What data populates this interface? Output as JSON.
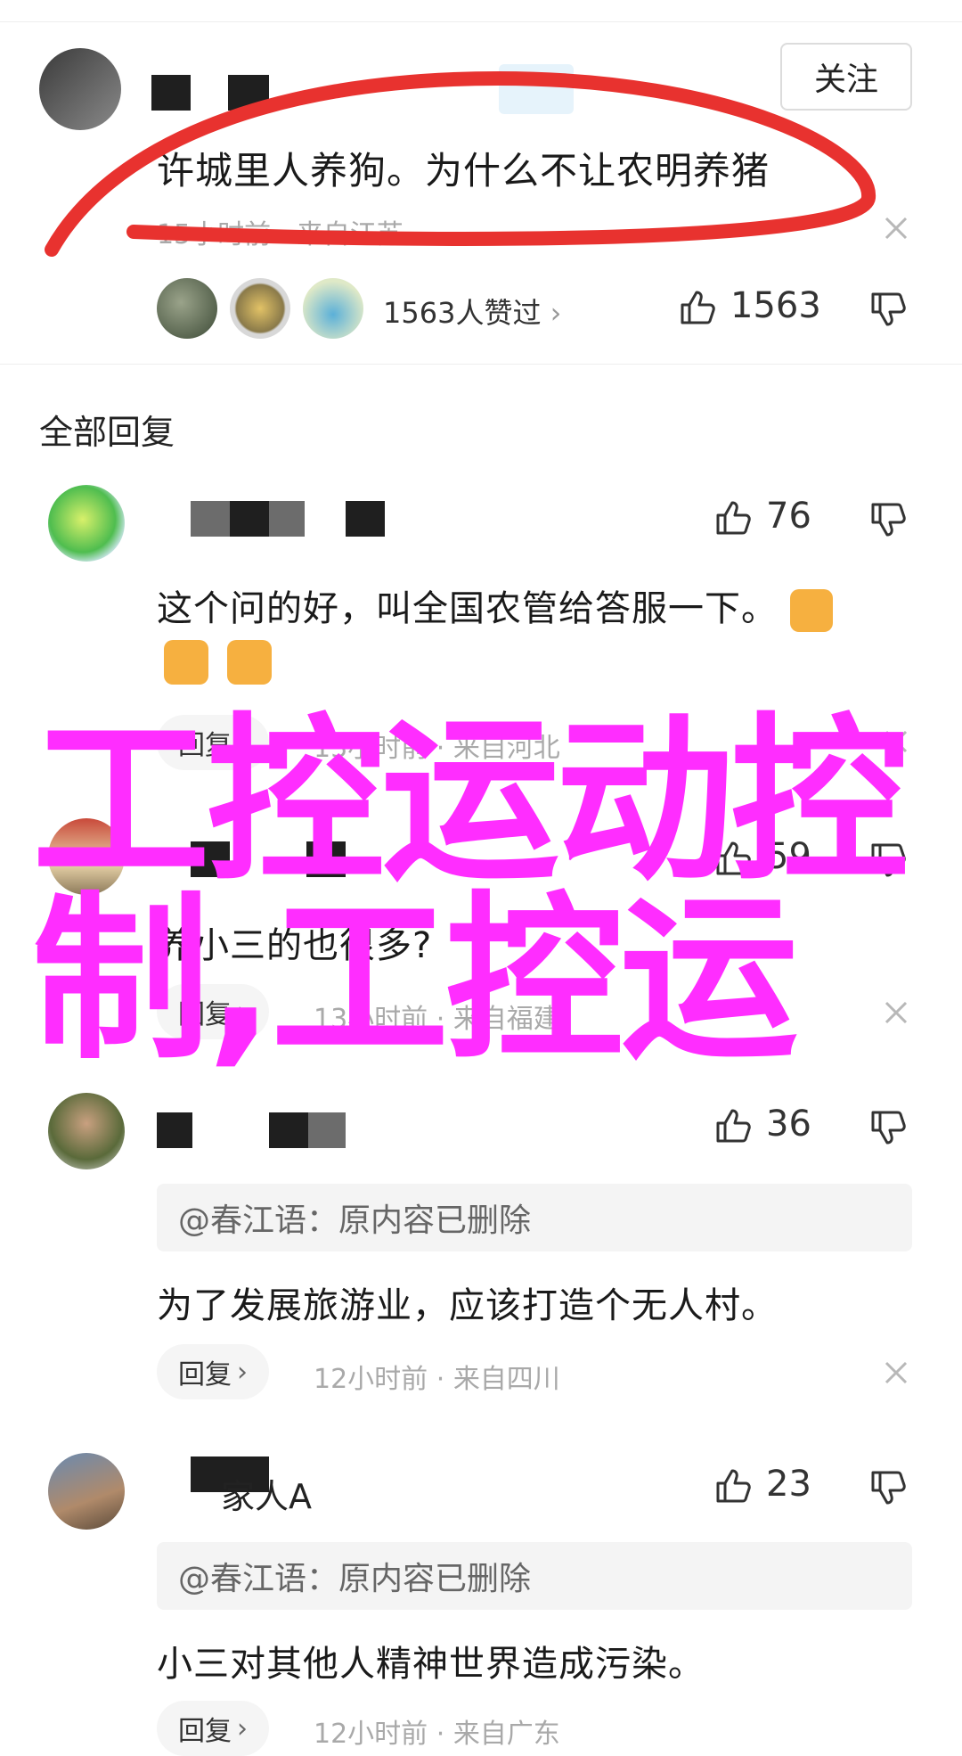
{
  "post": {
    "follow_label": "关注",
    "content": "许城里人养狗。为什么不让农明养猪",
    "time": "15小时前",
    "location": "来自江苏",
    "likes_summary": "1563人赞过",
    "like_count": "1563"
  },
  "replies_header": "全部回复",
  "comments": [
    {
      "like_count": "76",
      "text_line1": "这个问的好，叫全国农管给答服一下。",
      "reply_label": "回复",
      "time": "13小时前",
      "location": "来自河北"
    },
    {
      "like_count": "59",
      "text": "养小三的也很多?",
      "reply_label": "回复",
      "time": "13小时前",
      "location": "来自福建"
    },
    {
      "like_count": "36",
      "quote": "@春江语：原内容已删除",
      "text": "为了发展旅游业，应该打造个无人村。",
      "reply_label": "回复",
      "time": "12小时前",
      "location": "来自四川"
    },
    {
      "like_count": "23",
      "name_tail": "家人A",
      "quote": "@春江语：原内容已删除",
      "text": "小三对其他人精神世界造成污染。",
      "reply_label": "回复",
      "time": "12小时前",
      "location": "来自广东"
    }
  ],
  "watermark": {
    "line1": "工控运动控",
    "line2": "制,工控运"
  },
  "colors": {
    "watermark": "#ff2dff",
    "annotation": "#e8322f",
    "reply_pill_bg": "#f5f5f5"
  }
}
